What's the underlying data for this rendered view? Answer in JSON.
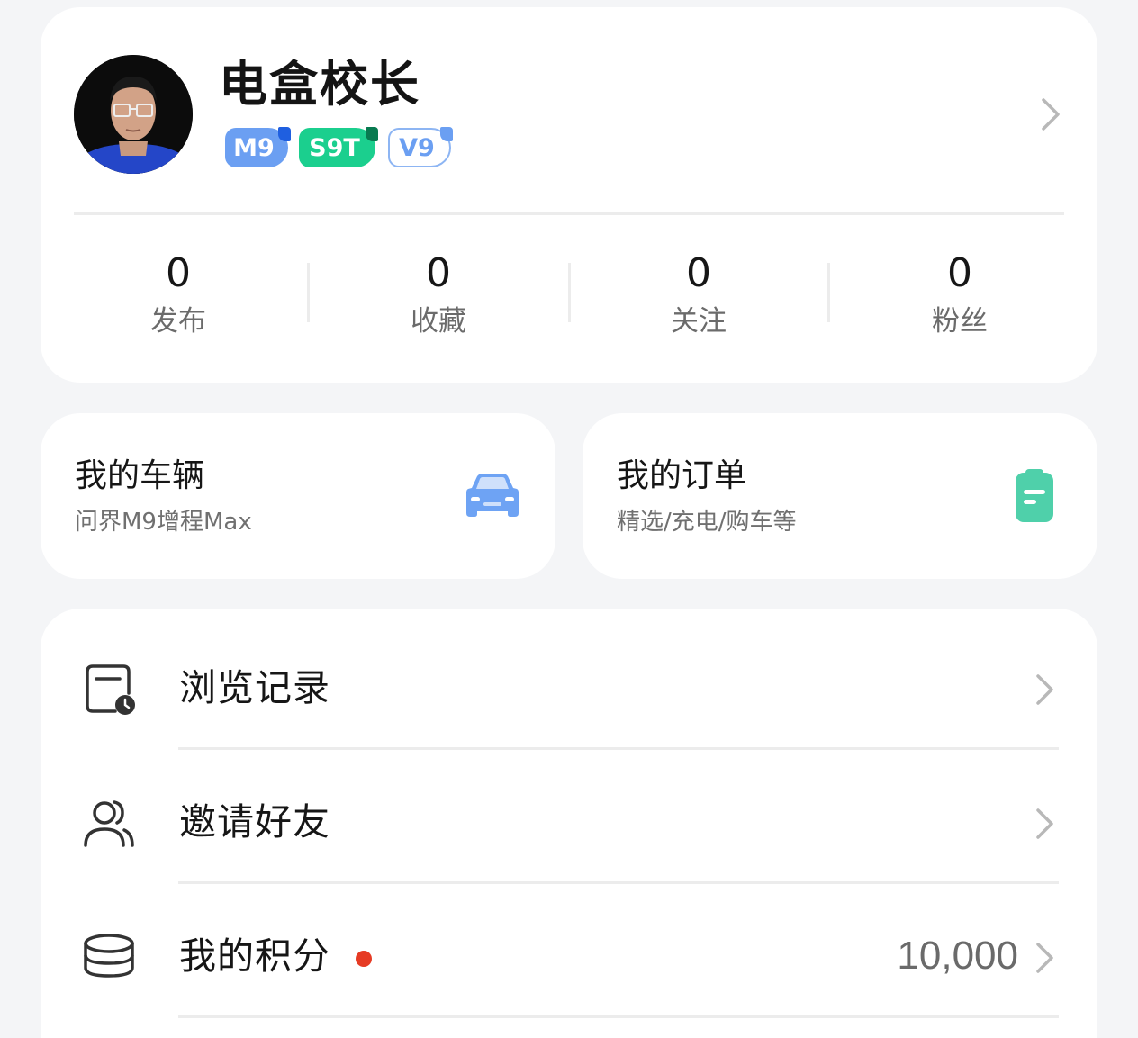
{
  "profile": {
    "username": "电盒校长",
    "badges": [
      "M9",
      "S9T",
      "V9"
    ],
    "colors": {
      "badge_m9": "#6b9ff2",
      "badge_s9t": "#1bcf8e",
      "badge_v9_outline": "#8db5f3"
    }
  },
  "stats": [
    {
      "value": "0",
      "label": "发布"
    },
    {
      "value": "0",
      "label": "收藏"
    },
    {
      "value": "0",
      "label": "关注"
    },
    {
      "value": "0",
      "label": "粉丝"
    }
  ],
  "vehicle": {
    "title": "我的车辆",
    "subtitle": "问界M9增程Max",
    "icon": "car-icon",
    "icon_color": "#6ea3f4"
  },
  "orders": {
    "title": "我的订单",
    "subtitle": "精选/充电/购车等",
    "icon": "order-clipboard-icon",
    "icon_color": "#4fd0aa"
  },
  "menu": [
    {
      "label": "浏览记录",
      "icon": "history-icon"
    },
    {
      "label": "邀请好友",
      "icon": "invite-friends-icon"
    },
    {
      "label": "我的积分",
      "icon": "points-coins-icon",
      "value": "10,000",
      "has_dot": true,
      "dot_color": "#e63b24"
    }
  ]
}
